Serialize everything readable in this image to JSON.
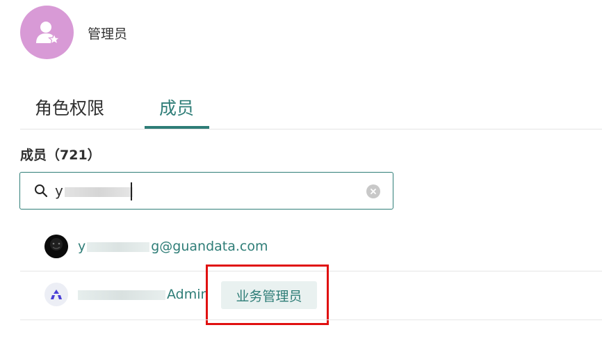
{
  "role": {
    "title": "管理员",
    "avatar_icon": "user-star-icon",
    "avatar_color": "#d89ad6"
  },
  "tabs": [
    {
      "label": "角色权限",
      "active": false
    },
    {
      "label": "成员",
      "active": true
    }
  ],
  "members": {
    "heading": "成员（721）",
    "search": {
      "value_prefix": "y",
      "icon": "search-icon",
      "clear_icon": "clear-icon"
    },
    "list": [
      {
        "prefix": "y",
        "suffix": "g@guandata.com",
        "avatar_icon": "black-avatar"
      },
      {
        "prefix": "",
        "suffix": "Admin",
        "avatar_icon": "brand-logo-icon",
        "tag": "业务管理员"
      }
    ]
  },
  "colors": {
    "accent": "#2e7d77",
    "highlight": "#e01010",
    "tag_bg": "#e9f1f0"
  }
}
